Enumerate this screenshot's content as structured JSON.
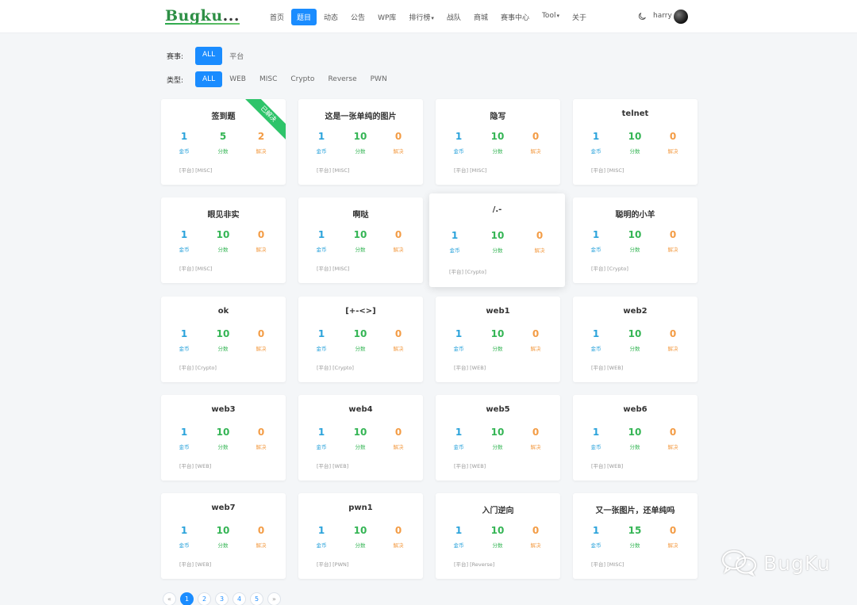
{
  "header": {
    "logo_main": "Bugku",
    "logo_tail": "...",
    "nav": [
      {
        "label": "首页",
        "active": false,
        "caret": false
      },
      {
        "label": "题目",
        "active": true,
        "caret": false
      },
      {
        "label": "动态",
        "active": false,
        "caret": false
      },
      {
        "label": "公告",
        "active": false,
        "caret": false
      },
      {
        "label": "WP库",
        "active": false,
        "caret": false
      },
      {
        "label": "排行榜",
        "active": false,
        "caret": true
      },
      {
        "label": "战队",
        "active": false,
        "caret": false
      },
      {
        "label": "商城",
        "active": false,
        "caret": false
      },
      {
        "label": "赛事中心",
        "active": false,
        "caret": false
      },
      {
        "label": "Tool",
        "active": false,
        "caret": true
      },
      {
        "label": "关于",
        "active": false,
        "caret": false
      }
    ],
    "username": "harry"
  },
  "filters": {
    "event_label": "赛事:",
    "event_options": [
      {
        "label": "ALL",
        "active": true
      },
      {
        "label": "平台",
        "active": false
      }
    ],
    "type_label": "类型:",
    "type_options": [
      {
        "label": "ALL",
        "active": true
      },
      {
        "label": "WEB",
        "active": false
      },
      {
        "label": "MISC",
        "active": false
      },
      {
        "label": "Crypto",
        "active": false
      },
      {
        "label": "Reverse",
        "active": false
      },
      {
        "label": "PWN",
        "active": false
      }
    ]
  },
  "stat_labels": {
    "coin": "金币",
    "score": "分数",
    "solve": "解决"
  },
  "cards": [
    {
      "title": "签到题",
      "coin": "1",
      "score": "5",
      "solve": "2",
      "tags": "[平台] [MISC]",
      "solved": true,
      "ribbon": "已解决"
    },
    {
      "title": "这是一张单纯的图片",
      "coin": "1",
      "score": "10",
      "solve": "0",
      "tags": "[平台] [MISC]"
    },
    {
      "title": "隐写",
      "coin": "1",
      "score": "10",
      "solve": "0",
      "tags": "[平台] [MISC]"
    },
    {
      "title": "telnet",
      "coin": "1",
      "score": "10",
      "solve": "0",
      "tags": "[平台] [MISC]"
    },
    {
      "title": "眼见非实",
      "coin": "1",
      "score": "10",
      "solve": "0",
      "tags": "[平台] [MISC]"
    },
    {
      "title": "啊哒",
      "coin": "1",
      "score": "10",
      "solve": "0",
      "tags": "[平台] [MISC]"
    },
    {
      "title": "/.-",
      "coin": "1",
      "score": "10",
      "solve": "0",
      "tags": "[平台] [Crypto]",
      "highlight": true
    },
    {
      "title": "聪明的小羊",
      "coin": "1",
      "score": "10",
      "solve": "0",
      "tags": "[平台] [Crypto]"
    },
    {
      "title": "ok",
      "coin": "1",
      "score": "10",
      "solve": "0",
      "tags": "[平台] [Crypto]"
    },
    {
      "title": "[+-<>]",
      "coin": "1",
      "score": "10",
      "solve": "0",
      "tags": "[平台] [Crypto]"
    },
    {
      "title": "web1",
      "coin": "1",
      "score": "10",
      "solve": "0",
      "tags": "[平台] [WEB]"
    },
    {
      "title": "web2",
      "coin": "1",
      "score": "10",
      "solve": "0",
      "tags": "[平台] [WEB]"
    },
    {
      "title": "web3",
      "coin": "1",
      "score": "10",
      "solve": "0",
      "tags": "[平台] [WEB]"
    },
    {
      "title": "web4",
      "coin": "1",
      "score": "10",
      "solve": "0",
      "tags": "[平台] [WEB]"
    },
    {
      "title": "web5",
      "coin": "1",
      "score": "10",
      "solve": "0",
      "tags": "[平台] [WEB]"
    },
    {
      "title": "web6",
      "coin": "1",
      "score": "10",
      "solve": "0",
      "tags": "[平台] [WEB]"
    },
    {
      "title": "web7",
      "coin": "1",
      "score": "10",
      "solve": "0",
      "tags": "[平台] [WEB]"
    },
    {
      "title": "pwn1",
      "coin": "1",
      "score": "10",
      "solve": "0",
      "tags": "[平台] [PWN]"
    },
    {
      "title": "入门逆向",
      "coin": "1",
      "score": "10",
      "solve": "0",
      "tags": "[平台] [Reverse]"
    },
    {
      "title": "又一张图片，还单纯吗",
      "coin": "1",
      "score": "15",
      "solve": "0",
      "tags": "[平台] [MISC]"
    }
  ],
  "pagination": {
    "prev": "«",
    "pages": [
      {
        "label": "1",
        "active": true
      },
      {
        "label": "2",
        "active": false
      },
      {
        "label": "3",
        "active": false
      },
      {
        "label": "4",
        "active": false
      },
      {
        "label": "5",
        "active": false
      }
    ],
    "next": "»"
  },
  "watermark": {
    "text": "BugKu"
  }
}
